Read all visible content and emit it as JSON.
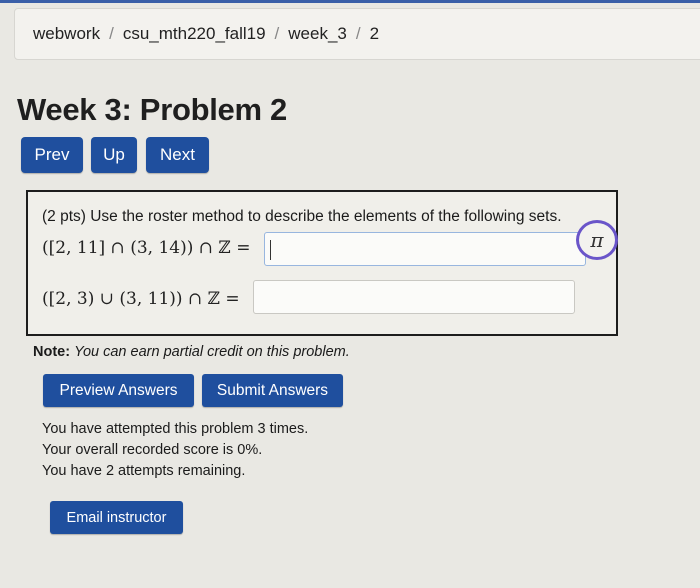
{
  "breadcrumb": {
    "items": [
      "webwork",
      "csu_mth220_fall19",
      "week_3",
      "2"
    ],
    "separator": "/"
  },
  "page_title": "Week 3: Problem 2",
  "nav": {
    "prev": "Prev",
    "up": "Up",
    "next": "Next"
  },
  "problem": {
    "statement": "(2 pts) Use the roster method to describe the elements of the following sets.",
    "parts": [
      {
        "expression": "([2, 11] ∩ (3, 14)) ∩ ℤ =",
        "answer_value": ""
      },
      {
        "expression": "([2, 3) ∪ (3, 11)) ∩ ℤ =",
        "answer_value": ""
      }
    ],
    "pi_button_symbol": "π"
  },
  "note": {
    "label": "Note:",
    "text": "You can earn partial credit on this problem."
  },
  "actions": {
    "preview": "Preview Answers",
    "submit": "Submit Answers"
  },
  "status": {
    "attempted": "You have attempted this problem 3 times.",
    "score": "Your overall recorded score is 0%.",
    "remaining": "You have 2 attempts remaining."
  },
  "email_button": "Email instructor",
  "colors": {
    "button_blue": "#1f4f9e",
    "pi_ring": "#6a55c9",
    "background": "#e9e8e3"
  }
}
